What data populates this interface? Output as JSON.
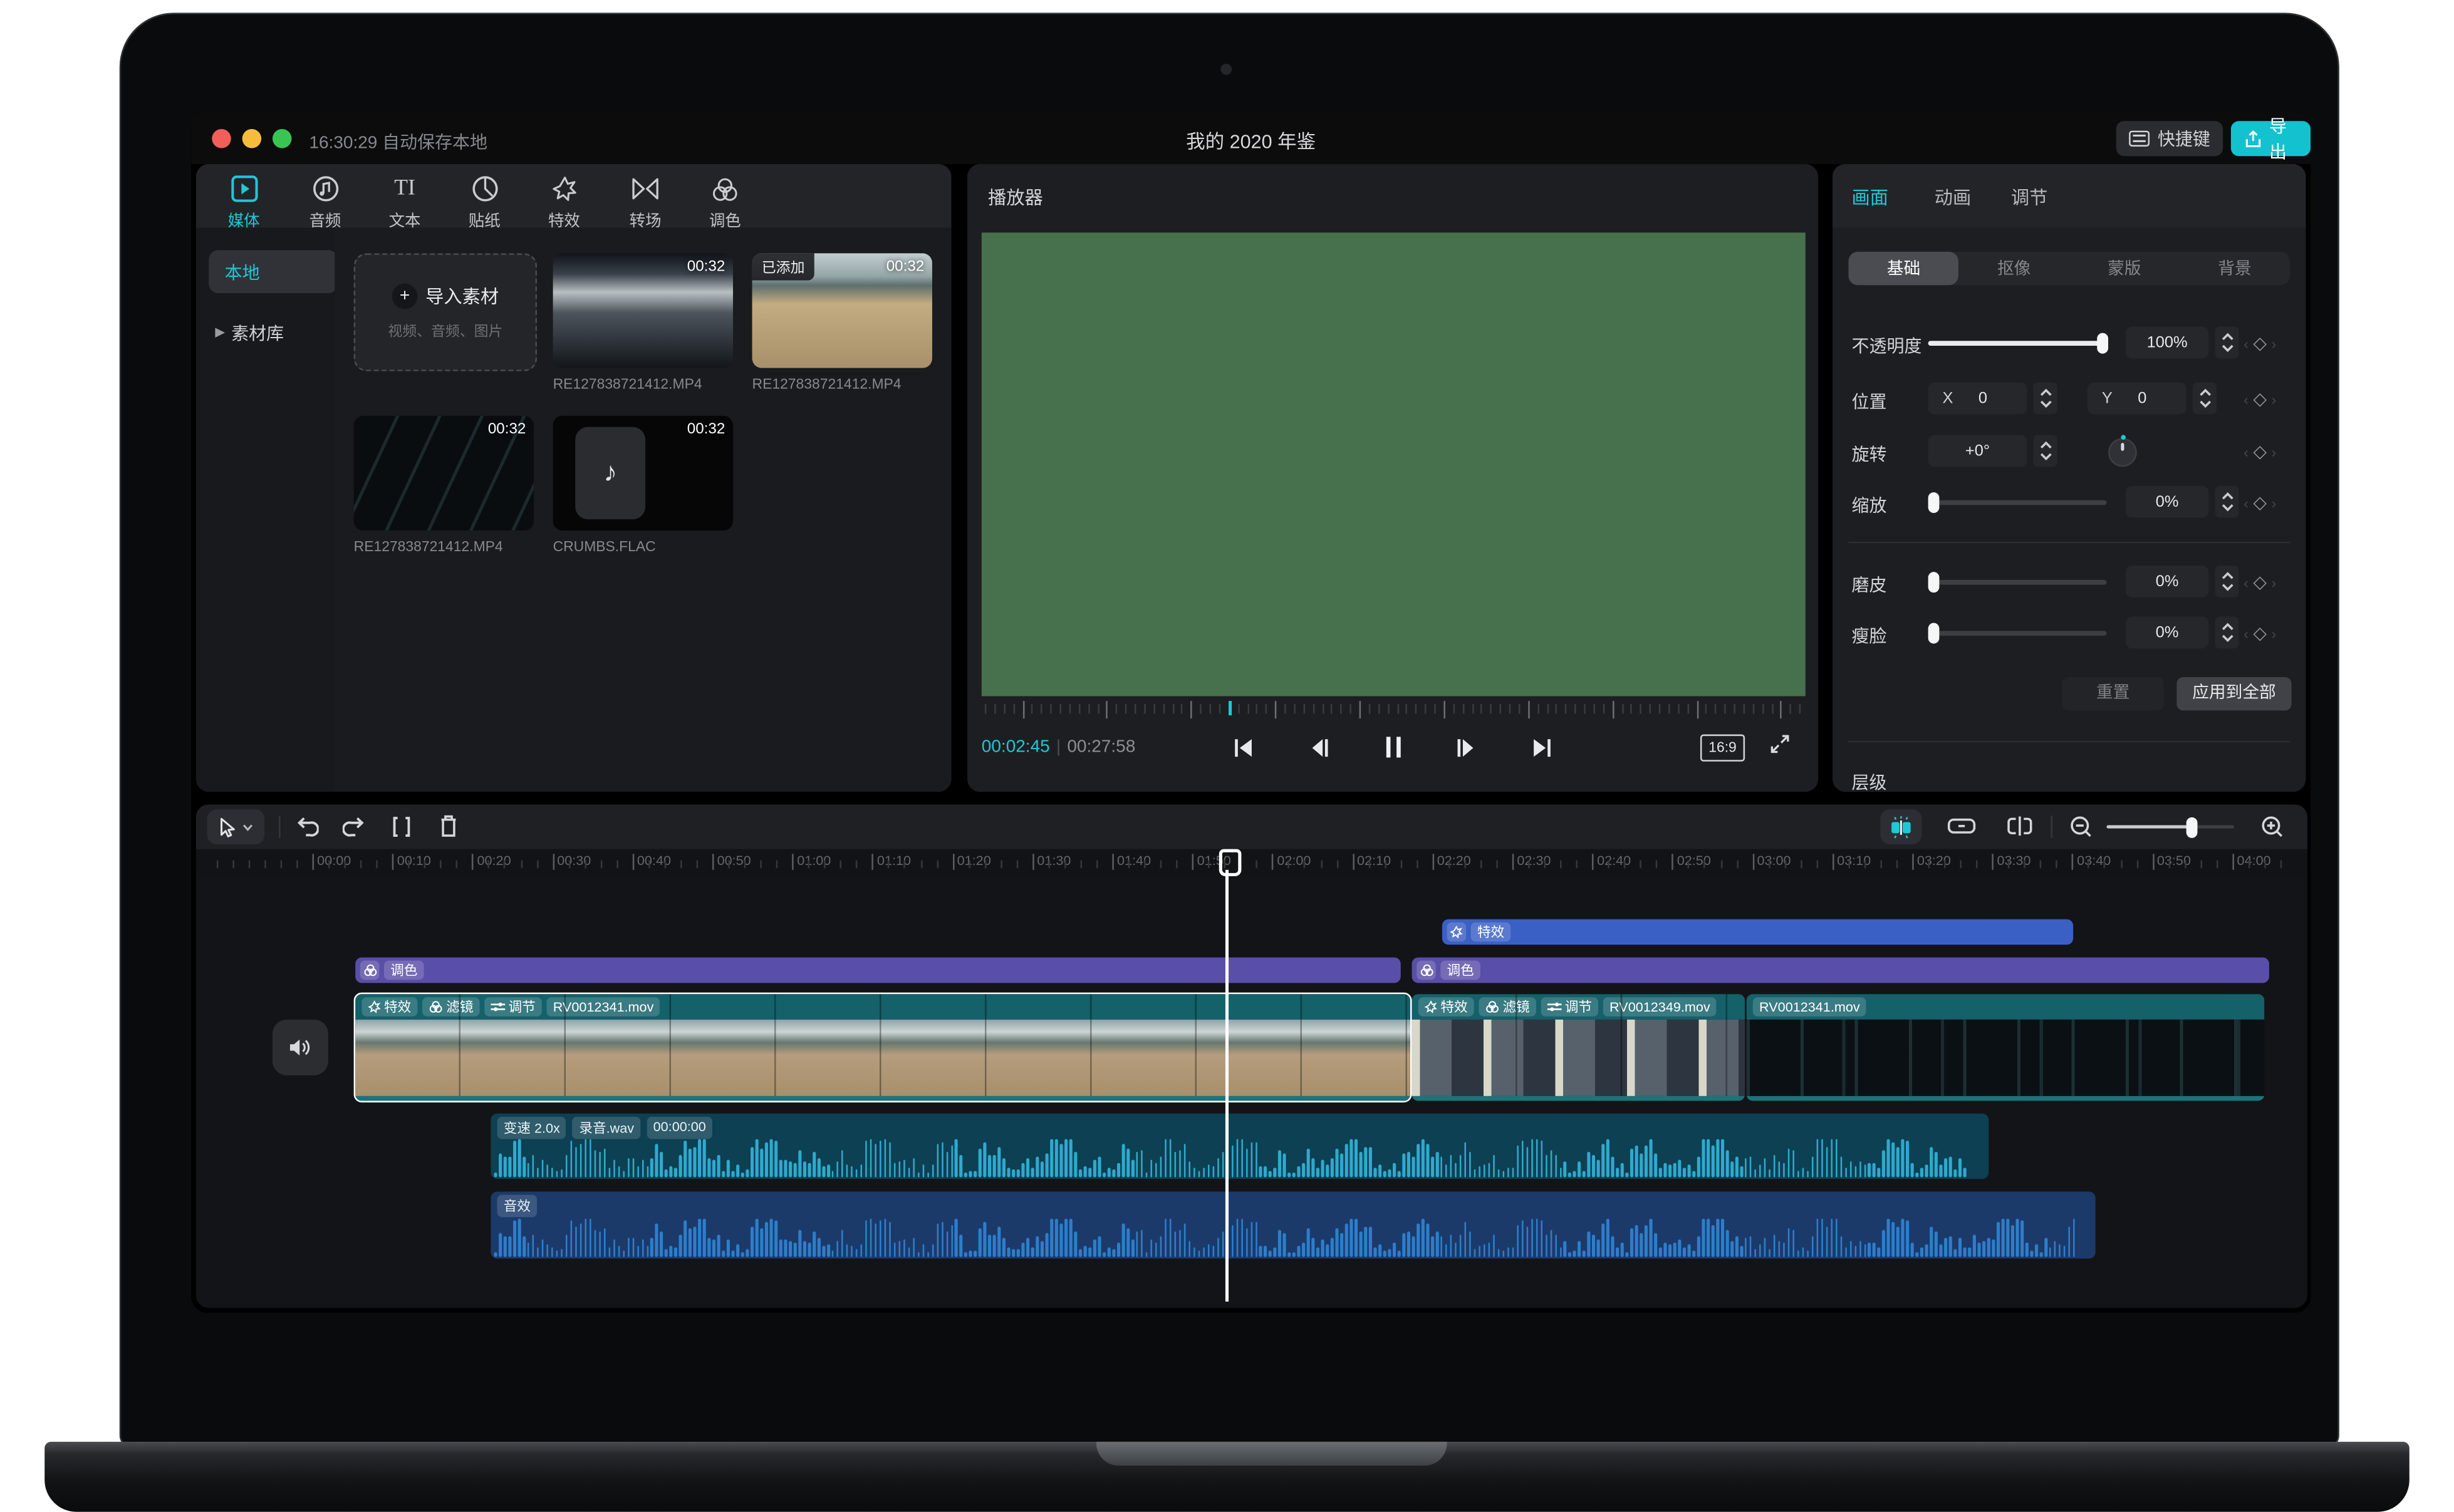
{
  "window": {
    "autosave": "16:30:29 自动保存本地",
    "title": "我的 2020 年鉴",
    "shortcut_btn": "快捷键",
    "export_btn": "导出"
  },
  "colors": {
    "accent": "#1ec8d6",
    "export_bg": "#13c2ce",
    "effect_bar_blue": "#3a60c6",
    "color_bar_purple": "#594fa8",
    "clip_header_teal": "#14616a",
    "audio1_bg": "#0c4052",
    "audio1_wave": "#2fa9cf",
    "audio2_bg": "#1b3a6a",
    "audio2_wave": "#2d7ecb",
    "player_canvas_green": "#47704c"
  },
  "media_panel": {
    "tabs": [
      {
        "label": "媒体"
      },
      {
        "label": "音频"
      },
      {
        "label": "文本"
      },
      {
        "label": "贴纸"
      },
      {
        "label": "特效"
      },
      {
        "label": "转场"
      },
      {
        "label": "调色"
      }
    ],
    "sidebar": [
      {
        "label": "本地"
      },
      {
        "label": "素材库"
      }
    ],
    "import_card": {
      "title": "导入素材",
      "subtitle": "视频、音频、图片"
    },
    "items": [
      {
        "name": "RE127838721412.MP4",
        "duration": "00:32"
      },
      {
        "name": "RE127838721412.MP4",
        "duration": "00:32",
        "badge": "已添加"
      },
      {
        "name": "RE127838721412.MP4",
        "duration": "00:32"
      },
      {
        "name": "CRUMBS.FLAC",
        "duration": "00:32",
        "note_icon": "♪"
      }
    ]
  },
  "player": {
    "header": "播放器",
    "current_time": "00:02:45",
    "total_time": "00:27:58",
    "ratio": "16:9"
  },
  "inspector": {
    "tabs": [
      {
        "label": "画面"
      },
      {
        "label": "动画"
      },
      {
        "label": "调节"
      }
    ],
    "subtabs": [
      {
        "label": "基础"
      },
      {
        "label": "抠像"
      },
      {
        "label": "蒙版"
      },
      {
        "label": "背景"
      }
    ],
    "opacity": {
      "label": "不透明度",
      "value": "100%"
    },
    "position": {
      "label": "位置",
      "x_label": "X",
      "x_value": "0",
      "y_label": "Y",
      "y_value": "0"
    },
    "rotation": {
      "label": "旋转",
      "value": "+0°"
    },
    "scale": {
      "label": "缩放",
      "value": "0%"
    },
    "smooth": {
      "label": "磨皮",
      "value": "0%"
    },
    "slim": {
      "label": "瘦脸",
      "value": "0%"
    },
    "reset_btn": "重置",
    "apply_all_btn": "应用到全部",
    "layer_label": "层级",
    "keyframe_diamond": "◇",
    "chevron_left": "‹",
    "chevron_right": "›"
  },
  "timeline": {
    "ruler_labels": [
      "00:00",
      "00:10",
      "00:20",
      "00:30",
      "00:40",
      "00:50",
      "01:00",
      "01:10",
      "01:20",
      "01:30",
      "01:40",
      "01:50",
      "02:00",
      "02:10",
      "02:20",
      "02:30",
      "02:40",
      "02:50",
      "03:00",
      "03:10",
      "03:20",
      "03:30",
      "03:40",
      "03:50",
      "04:00"
    ],
    "effect_bar": {
      "label": "特效"
    },
    "color_bar_1": {
      "label": "调色"
    },
    "color_bar_2": {
      "label": "调色"
    },
    "clips": [
      {
        "badges": [
          "特效",
          "滤镜",
          "调节"
        ],
        "name": "RV0012341.mov"
      },
      {
        "badges": [
          "特效",
          "滤镜",
          "调节"
        ],
        "name": "RV0012349.mov"
      },
      {
        "name": "RV0012341.mov"
      }
    ],
    "audio1": {
      "badges": [
        "变速 2.0x",
        "录音.wav",
        "00:00:00"
      ]
    },
    "audio2": {
      "label": "音效"
    }
  }
}
